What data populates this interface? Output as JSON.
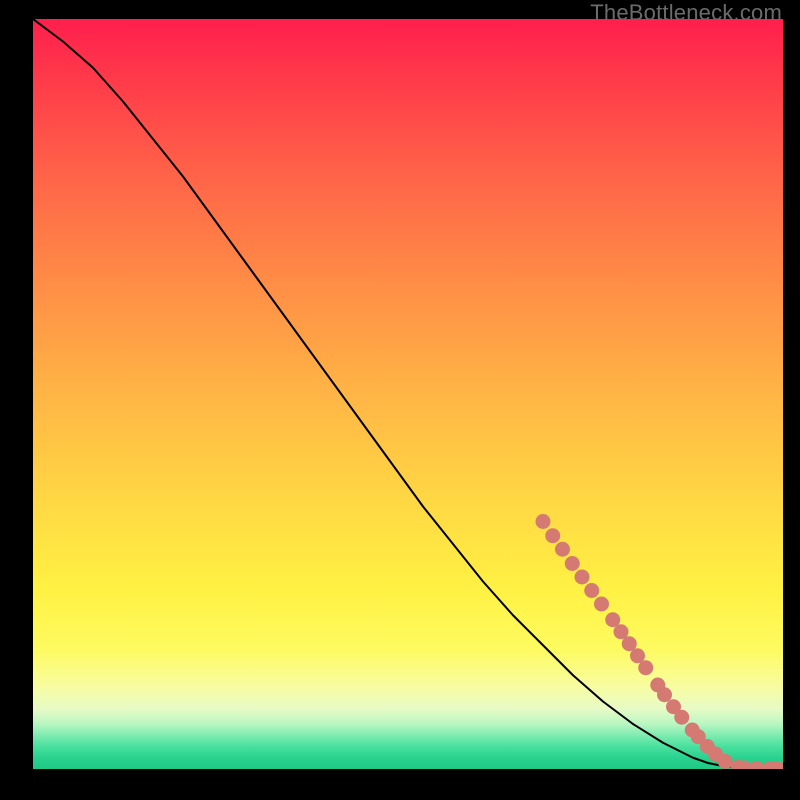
{
  "watermark": "TheBottleneck.com",
  "colors": {
    "curve_stroke": "#000000",
    "dot_fill": "#d47a72",
    "background_black": "#000000"
  },
  "chart_data": {
    "type": "line",
    "title": "",
    "xlabel": "",
    "ylabel": "",
    "xlim": [
      0,
      100
    ],
    "ylim": [
      0,
      100
    ],
    "series": [
      {
        "name": "bottleneck-curve",
        "x": [
          0,
          4,
          8,
          12,
          16,
          20,
          24,
          28,
          32,
          36,
          40,
          44,
          48,
          52,
          56,
          60,
          64,
          68,
          72,
          76,
          80,
          84,
          88,
          90,
          92,
          94,
          96,
          98,
          100
        ],
        "y": [
          100,
          97,
          93.5,
          89,
          84,
          79,
          73.5,
          68,
          62.5,
          57,
          51.5,
          46,
          40.5,
          35,
          30,
          25,
          20.5,
          16.5,
          12.5,
          9,
          6,
          3.5,
          1.5,
          0.8,
          0.4,
          0.2,
          0.1,
          0.05,
          0.0
        ]
      }
    ],
    "dots": [
      {
        "segment": "thick",
        "points": [
          {
            "x": 68.0,
            "y": 33.0
          },
          {
            "x": 69.3,
            "y": 31.1
          },
          {
            "x": 70.6,
            "y": 29.3
          },
          {
            "x": 71.9,
            "y": 27.4
          },
          {
            "x": 73.2,
            "y": 25.6
          },
          {
            "x": 74.5,
            "y": 23.8
          },
          {
            "x": 75.8,
            "y": 22.0
          }
        ]
      },
      {
        "segment": "thick2",
        "points": [
          {
            "x": 77.3,
            "y": 19.9
          },
          {
            "x": 78.4,
            "y": 18.3
          },
          {
            "x": 79.5,
            "y": 16.7
          },
          {
            "x": 80.6,
            "y": 15.1
          },
          {
            "x": 81.7,
            "y": 13.5
          }
        ]
      },
      {
        "segment": "mid",
        "points": [
          {
            "x": 83.3,
            "y": 11.2
          },
          {
            "x": 84.2,
            "y": 9.9
          },
          {
            "x": 85.4,
            "y": 8.3
          },
          {
            "x": 86.5,
            "y": 6.9
          }
        ]
      },
      {
        "segment": "mid2",
        "points": [
          {
            "x": 87.9,
            "y": 5.2
          },
          {
            "x": 88.7,
            "y": 4.3
          }
        ]
      },
      {
        "segment": "low",
        "points": [
          {
            "x": 89.9,
            "y": 3.0
          },
          {
            "x": 91.0,
            "y": 2.0
          }
        ]
      },
      {
        "segment": "low2",
        "points": [
          {
            "x": 92.3,
            "y": 1.0
          }
        ]
      },
      {
        "segment": "tail",
        "points": [
          {
            "x": 94.0,
            "y": 0.2
          },
          {
            "x": 94.8,
            "y": 0.15
          }
        ]
      },
      {
        "segment": "tail2",
        "points": [
          {
            "x": 96.5,
            "y": 0.08
          }
        ]
      },
      {
        "segment": "tail3",
        "points": [
          {
            "x": 98.3,
            "y": 0.03
          },
          {
            "x": 99.3,
            "y": 0.01
          }
        ]
      }
    ]
  }
}
